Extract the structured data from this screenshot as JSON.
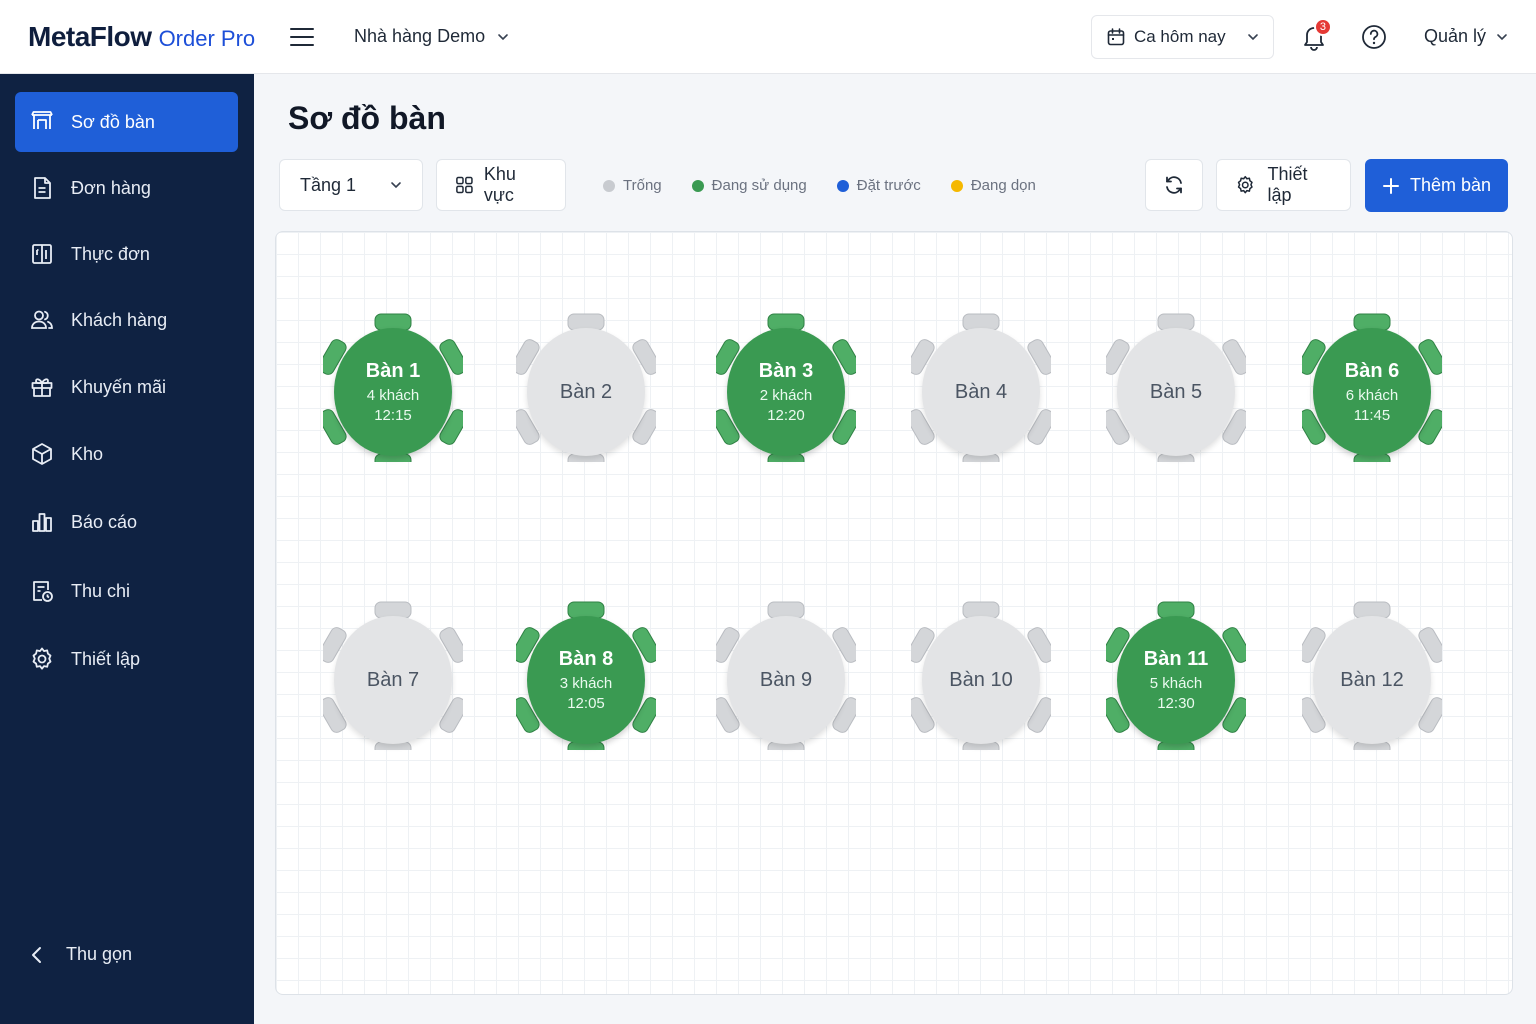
{
  "header": {
    "brand_main": "MetaFlow",
    "brand_sub": "Order Pro",
    "store": "Nhà hàng Demo",
    "shift": "Ca hôm nay",
    "notification_count": "3",
    "user": "Quản lý"
  },
  "sidebar": {
    "items": [
      {
        "label": "Sơ đồ bàn",
        "icon": "table-icon",
        "active": true
      },
      {
        "label": "Đơn hàng",
        "icon": "document-icon"
      },
      {
        "label": "Thực đơn",
        "icon": "menu-book-icon"
      },
      {
        "label": "Khách hàng",
        "icon": "users-icon"
      },
      {
        "label": "Khuyến mãi",
        "icon": "gift-icon"
      },
      {
        "label": "Kho",
        "icon": "box-icon"
      },
      {
        "label": "Báo cáo",
        "icon": "bar-chart-icon"
      },
      {
        "label": "Thu chi",
        "icon": "finance-icon"
      },
      {
        "label": "Thiết lập",
        "icon": "gear-icon"
      }
    ],
    "collapse_label": "Thu gọn"
  },
  "main": {
    "title": "Sơ đồ bàn",
    "floor": "Tầng 1",
    "zone_label": "Khu vực",
    "legend": [
      {
        "label": "Trống",
        "color": "#c8cbd0"
      },
      {
        "label": "Đang sử dụng",
        "color": "#3a9a52"
      },
      {
        "label": "Đặt trước",
        "color": "#1f5fd8"
      },
      {
        "label": "Đang dọn",
        "color": "#f5b800"
      }
    ],
    "settings_label": "Thiết lập",
    "add_label": "Thêm bàn"
  },
  "colors": {
    "occupied": "#3a9a52",
    "occupied_chair": "#4fae66",
    "empty": "#e3e4e6",
    "empty_chair": "#d4d6d9",
    "accent": "#1f5fd8",
    "sidebar": "#0f2242"
  },
  "tables": [
    {
      "name": "Bàn 1",
      "status": "occupied",
      "guests": "4 khách",
      "time": "12:15"
    },
    {
      "name": "Bàn 2",
      "status": "empty"
    },
    {
      "name": "Bàn 3",
      "status": "occupied",
      "guests": "2 khách",
      "time": "12:20"
    },
    {
      "name": "Bàn 4",
      "status": "empty"
    },
    {
      "name": "Bàn 5",
      "status": "empty"
    },
    {
      "name": "Bàn 6",
      "status": "occupied",
      "guests": "6 khách",
      "time": "11:45"
    },
    {
      "name": "Bàn 7",
      "status": "empty"
    },
    {
      "name": "Bàn 8",
      "status": "occupied",
      "guests": "3 khách",
      "time": "12:05"
    },
    {
      "name": "Bàn 9",
      "status": "empty"
    },
    {
      "name": "Bàn 10",
      "status": "empty"
    },
    {
      "name": "Bàn 11",
      "status": "occupied",
      "guests": "5 khách",
      "time": "12:30"
    },
    {
      "name": "Bàn 12",
      "status": "empty"
    }
  ]
}
